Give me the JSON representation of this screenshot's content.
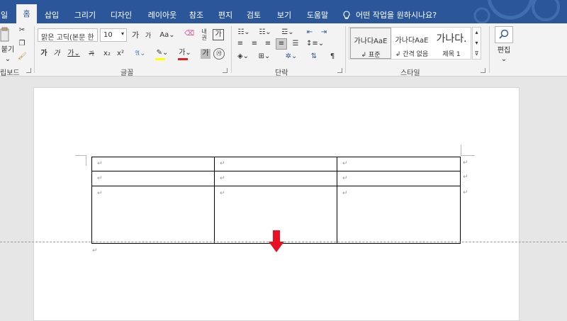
{
  "tabs": {
    "items": [
      "일",
      "홈",
      "삽입",
      "그리기",
      "디자인",
      "레이아웃",
      "참조",
      "편지",
      "검토",
      "보기",
      "도움말"
    ],
    "active_index": 1,
    "tell_me": "어떤 작업을 원하시나요?"
  },
  "clipboard": {
    "paste_label": "붙기",
    "group_label": "립보드"
  },
  "font": {
    "name": "맑은 고딕(본문 한",
    "size": "10",
    "group_label": "글꼴"
  },
  "paragraph": {
    "group_label": "단락"
  },
  "styles": {
    "group_label": "스타일",
    "items": [
      {
        "sample": "가나다AaE",
        "name": "↲ 표준"
      },
      {
        "sample": "가나다AaE",
        "name": "↲ 간격 없음"
      },
      {
        "sample": "가나다.",
        "name": "제목 1"
      }
    ]
  },
  "editing": {
    "label": "편집"
  },
  "document": {
    "para_mark": "↵",
    "table_rows": 3,
    "table_cols": 3
  },
  "colors": {
    "ribbon_blue": "#2b579a",
    "arrow_red": "#e81123"
  }
}
